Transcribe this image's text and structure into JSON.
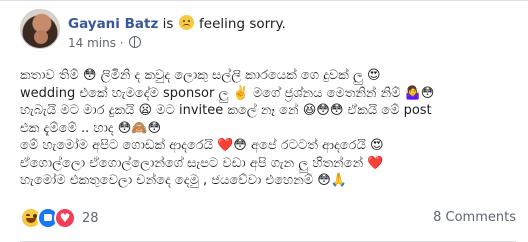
{
  "post": {
    "author": "Gayani Batz",
    "is_text": "is",
    "feeling": "feeling sorry.",
    "feeling_icon": "sad-face-icon",
    "timestamp": "14 mins",
    "privacy_icon": "globe-icon",
    "lines": [
      "කතාව තිම් 😳 ලිමිනි ද කවුද ලොකු සල්ලි කාරයෙක් ගෙ දුවක් ලු 😍",
      "wedding එකේ හැමදේම sponsor ලු ✌️ මගේ ජ්‍රශ්නය මෙතනින් නිම් 🤷‍♀️😳",
      "හැබැයි මට මාර දුකයි 😦 මට invitee කලේ නෑ නේ 😆😳😳 ඒකයි මේ post",
      "එක දැම්මේ .. හාද 😳🙈😳",
      "මේ හැමෝම අපිට ගොඩක් ආදරෙයි ❤️😳 අපේ රටටත් ආදරෙයි 😍",
      "ඒගොල්ලො ඒගොල්ලොන්ගේ සැපට වඩා අපි ගැන ලු හිතන්නේ ❤️",
      "හැමෝම එකතුවෙලා චන්දෙ දෙමු , ජයවේවා එහෙනම් 😳🙏"
    ]
  },
  "footer": {
    "reaction_icons": [
      "haha-icon",
      "like-icon",
      "love-icon"
    ],
    "reaction_count": "28",
    "comments": "8 Comments"
  }
}
